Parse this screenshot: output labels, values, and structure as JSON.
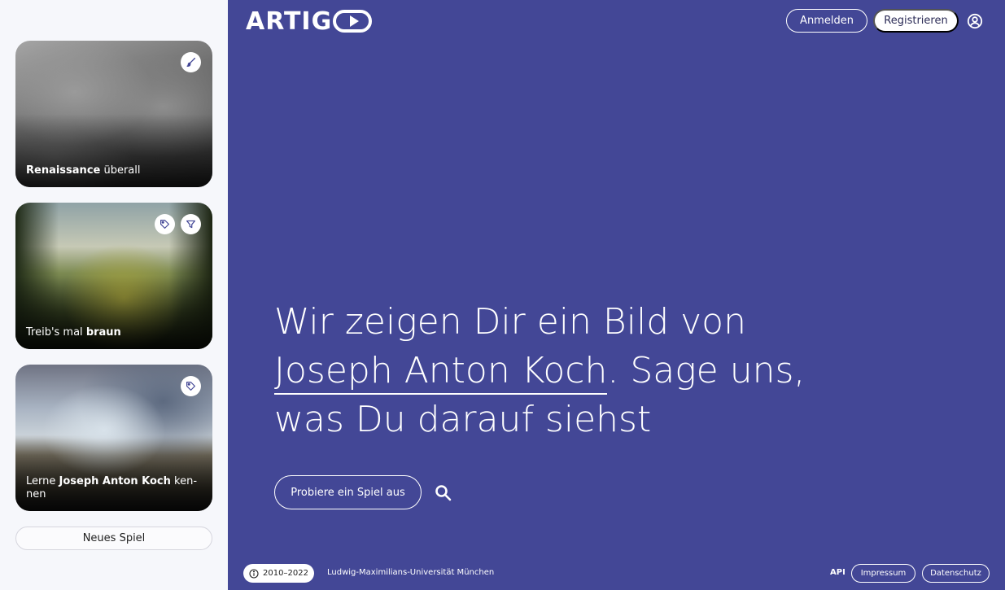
{
  "sidebar": {
    "cards": [
      {
        "bold": "Renaissance",
        "rest": " überall",
        "badges": [
          "brush-icon"
        ]
      },
      {
        "prefix": "Treib's mal ",
        "bold": "braun",
        "badges": [
          "tag-icon",
          "filter-icon"
        ]
      },
      {
        "prefix": "Lerne ",
        "bold": "Joseph Anton Koch",
        "rest": " ken-nen",
        "badges": [
          "tag-icon"
        ]
      }
    ],
    "new_game_label": "Neues Spiel"
  },
  "header": {
    "logo": "ARTIG",
    "login_label": "Anmelden",
    "register_label": "Registrieren"
  },
  "hero": {
    "line_before": "Wir zeigen Dir ein Bild von",
    "artist": "Joseph Anton Koch",
    "line_after": ". Sage uns, was Du darauf siehst",
    "cta_label": "Probiere ein Spiel aus"
  },
  "footer": {
    "years": "2010–2022",
    "university": "Ludwig-Maximilians-Universität München",
    "api_label": "API",
    "impressum_label": "Impressum",
    "datenschutz_label": "Datenschutz"
  },
  "colors": {
    "main_bg": "#434796",
    "sidebar_bg": "#f6f7fb",
    "accent": "#ffffff"
  }
}
